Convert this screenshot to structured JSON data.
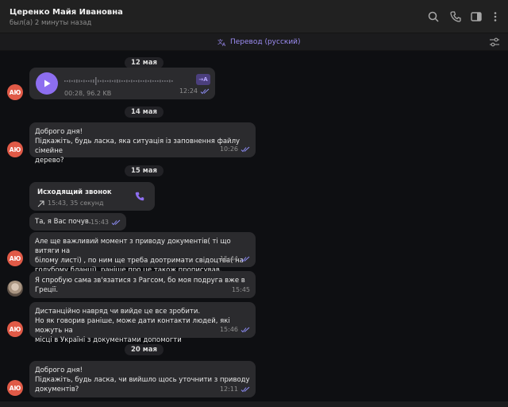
{
  "header": {
    "name": "Церенко Майя Ивановна",
    "status": "был(а) 2 минуты назад"
  },
  "translate_bar": {
    "label": "Перевод (русский)"
  },
  "colors": {
    "accent": "#8d6ef0",
    "avatar": "#e05a47"
  },
  "dates": {
    "d1": "12 мая",
    "d2": "14 мая",
    "d3": "15 мая",
    "d4": "20 мая"
  },
  "messages": {
    "voice": {
      "info": "00:28, 96.2 KB",
      "time": "12:24",
      "transcribe": "→A"
    },
    "m1": {
      "text": "Доброго дня!\nПідкажіть, будь ласка, яка ситуація із заповнення файлу сімейне\nдерево?",
      "time": "10:26"
    },
    "call": {
      "title": "Исходящий звонок",
      "sub": "15:43, 35 секунд"
    },
    "m2": {
      "text": "Та, я Вас почув.",
      "time": "15:43"
    },
    "m3": {
      "text": "Але ще важливий момент з приводу документів( ті що витяги на\nбілому листі) , по ним ще треба доотримати свідоцтва( на\nголубому бланці), раніше про це також прописував.",
      "time": "15:44"
    },
    "m4": {
      "text": "Я спробую сама зв'язатися з Рагсом, бо моя подруга вже в\nГреції.",
      "time": "15:45"
    },
    "m5": {
      "text": "Дистанційно  навряд чи вийде це все зробити.\nНо як говорив раніше, може дати контакти людей, які можуть на\nмісці в Україні з документами допомогти",
      "time": "15:46"
    },
    "m6": {
      "text": "Доброго дня!\nПідкажіть, будь ласка, чи вийшло щось уточнити з приводу\nдокументів?",
      "time": "12:11"
    }
  },
  "avatar_initials": "АЮ"
}
